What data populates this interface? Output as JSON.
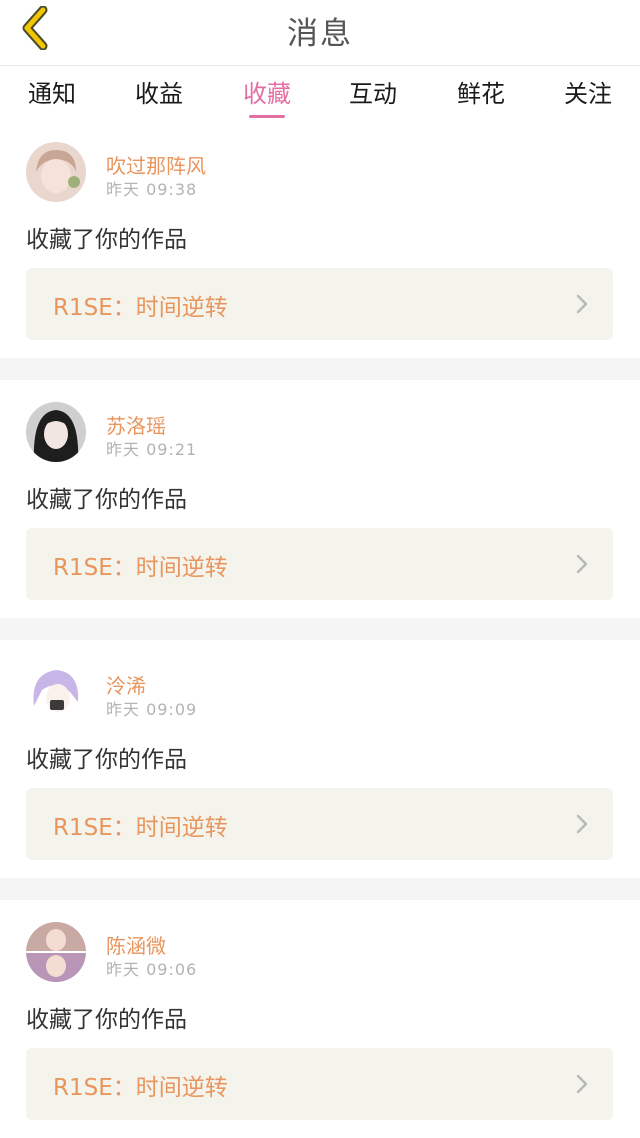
{
  "header": {
    "title": "消息",
    "back_icon": "chevron-left-icon",
    "back_color": "#f2c600"
  },
  "tabs": [
    {
      "label": "通知",
      "active": false
    },
    {
      "label": "收益",
      "active": false
    },
    {
      "label": "收藏",
      "active": true
    },
    {
      "label": "互动",
      "active": false
    },
    {
      "label": "鲜花",
      "active": false
    },
    {
      "label": "关注",
      "active": false
    }
  ],
  "colors": {
    "accent": "#e46fa4",
    "name": "#e8955e",
    "work_bg": "#f4f4ec"
  },
  "messages": [
    {
      "name": "吹过那阵风",
      "time": "昨天 09:38",
      "action": "收藏了你的作品",
      "work_title": "R1SE：时间逆转"
    },
    {
      "name": "苏洛瑶",
      "time": "昨天 09:21",
      "action": "收藏了你的作品",
      "work_title": "R1SE：时间逆转"
    },
    {
      "name": "泠浠",
      "time": "昨天 09:09",
      "action": "收藏了你的作品",
      "work_title": "R1SE：时间逆转"
    },
    {
      "name": "陈涵微",
      "time": "昨天 09:06",
      "action": "收藏了你的作品",
      "work_title": "R1SE：时间逆转"
    }
  ]
}
